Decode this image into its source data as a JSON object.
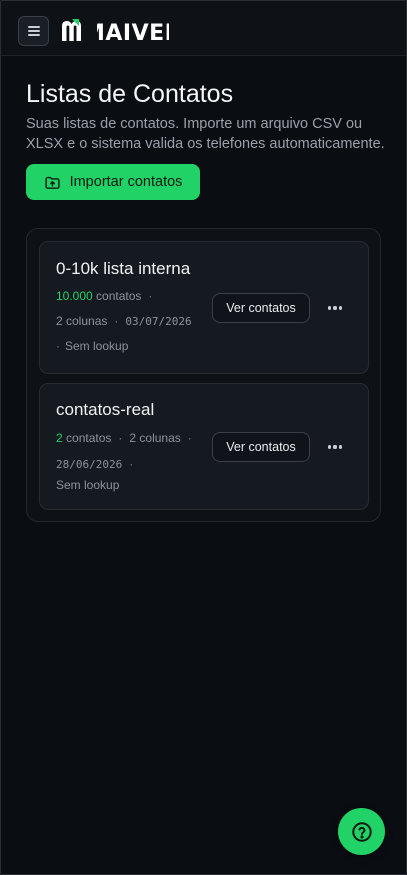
{
  "brand": {
    "name": "MAIVER",
    "accent": "#21d366"
  },
  "header": {
    "menu_icon": "hamburger-icon"
  },
  "page": {
    "title": "Listas de Contatos",
    "subtitle": "Suas listas de contatos. Importe um arquivo CSV ou XLSX e o sistema valida os telefones automaticamente.",
    "import_label": "Importar contatos",
    "import_icon": "folder-upload-icon"
  },
  "lists": [
    {
      "name": "0-10k lista interna",
      "count": "10.000",
      "count_suffix": "contatos",
      "columns": "2 colunas",
      "date": "03/07/2026",
      "lookup": "Sem lookup",
      "view_label": "Ver contatos",
      "more_icon": "more-horizontal-icon"
    },
    {
      "name": "contatos-real",
      "count": "2",
      "count_suffix": "contatos",
      "columns": "2 colunas",
      "date": "28/06/2026",
      "lookup": "Sem lookup",
      "view_label": "Ver contatos",
      "more_icon": "more-horizontal-icon"
    }
  ],
  "help": {
    "icon": "help-circle-icon"
  }
}
